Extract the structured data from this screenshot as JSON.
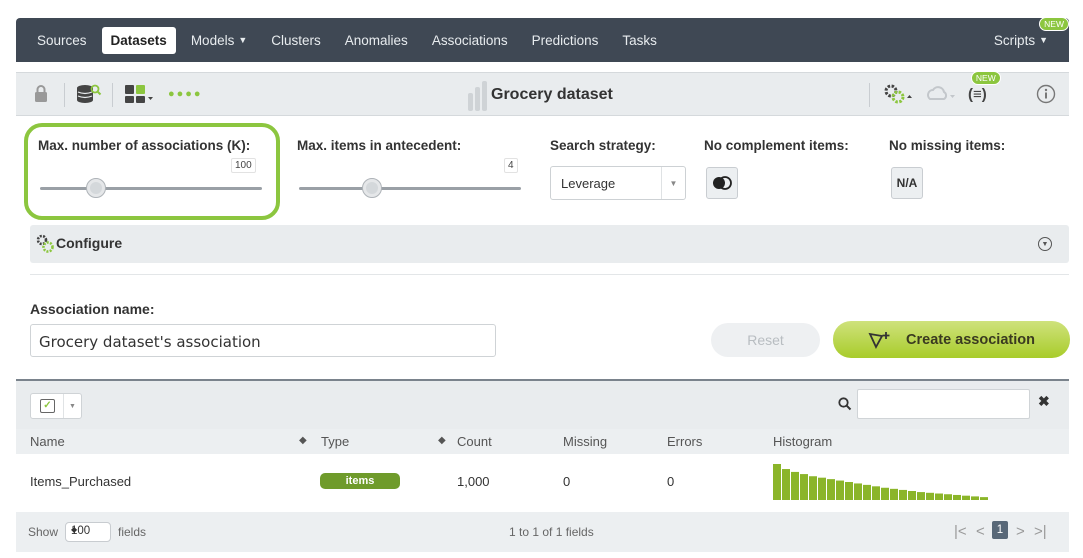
{
  "nav": {
    "items": [
      {
        "label": "Sources",
        "active": false,
        "caret": false
      },
      {
        "label": "Datasets",
        "active": true,
        "caret": false
      },
      {
        "label": "Models",
        "active": false,
        "caret": true
      },
      {
        "label": "Clusters",
        "active": false,
        "caret": false
      },
      {
        "label": "Anomalies",
        "active": false,
        "caret": false
      },
      {
        "label": "Associations",
        "active": false,
        "caret": false
      },
      {
        "label": "Predictions",
        "active": false,
        "caret": false
      },
      {
        "label": "Tasks",
        "active": false,
        "caret": false
      }
    ],
    "scripts_label": "Scripts",
    "new_badge": "NEW"
  },
  "toolbar": {
    "title": "Grocery dataset",
    "new_badge": "NEW"
  },
  "config": {
    "max_assoc_label": "Max. number of associations (K):",
    "max_assoc_value": "100",
    "max_assoc_level": 0.25,
    "max_items_label": "Max. items in antecedent:",
    "max_items_value": "4",
    "max_items_level": 0.33,
    "search_strategy_label": "Search strategy:",
    "search_strategy_value": "Leverage",
    "no_complement_label": "No complement items:",
    "no_missing_label": "No missing items:",
    "no_missing_value": "N/A",
    "configure_label": "Configure"
  },
  "association": {
    "name_label": "Association name:",
    "name_value": "Grocery dataset's association",
    "reset_label": "Reset",
    "create_label": "Create association"
  },
  "table": {
    "columns": [
      "Name",
      "Type",
      "Count",
      "Missing",
      "Errors",
      "Histogram"
    ],
    "rows": [
      {
        "name": "Items_Purchased",
        "type": "items",
        "count": "1,000",
        "missing": "0",
        "errors": "0"
      }
    ],
    "histogram_heights": [
      1.0,
      0.86,
      0.78,
      0.72,
      0.66,
      0.62,
      0.58,
      0.54,
      0.5,
      0.46,
      0.42,
      0.38,
      0.34,
      0.31,
      0.28,
      0.25,
      0.22,
      0.2,
      0.18,
      0.16,
      0.14,
      0.12,
      0.1,
      0.08
    ],
    "footer_show": "Show",
    "footer_page_size": "100",
    "footer_fields": "fields",
    "footer_range": "1 to 1 of 1 fields",
    "current_page": "1"
  },
  "colors": {
    "accent": "#8cc63f",
    "nav_bg": "#3f4854",
    "histogram": "#8bb529"
  }
}
